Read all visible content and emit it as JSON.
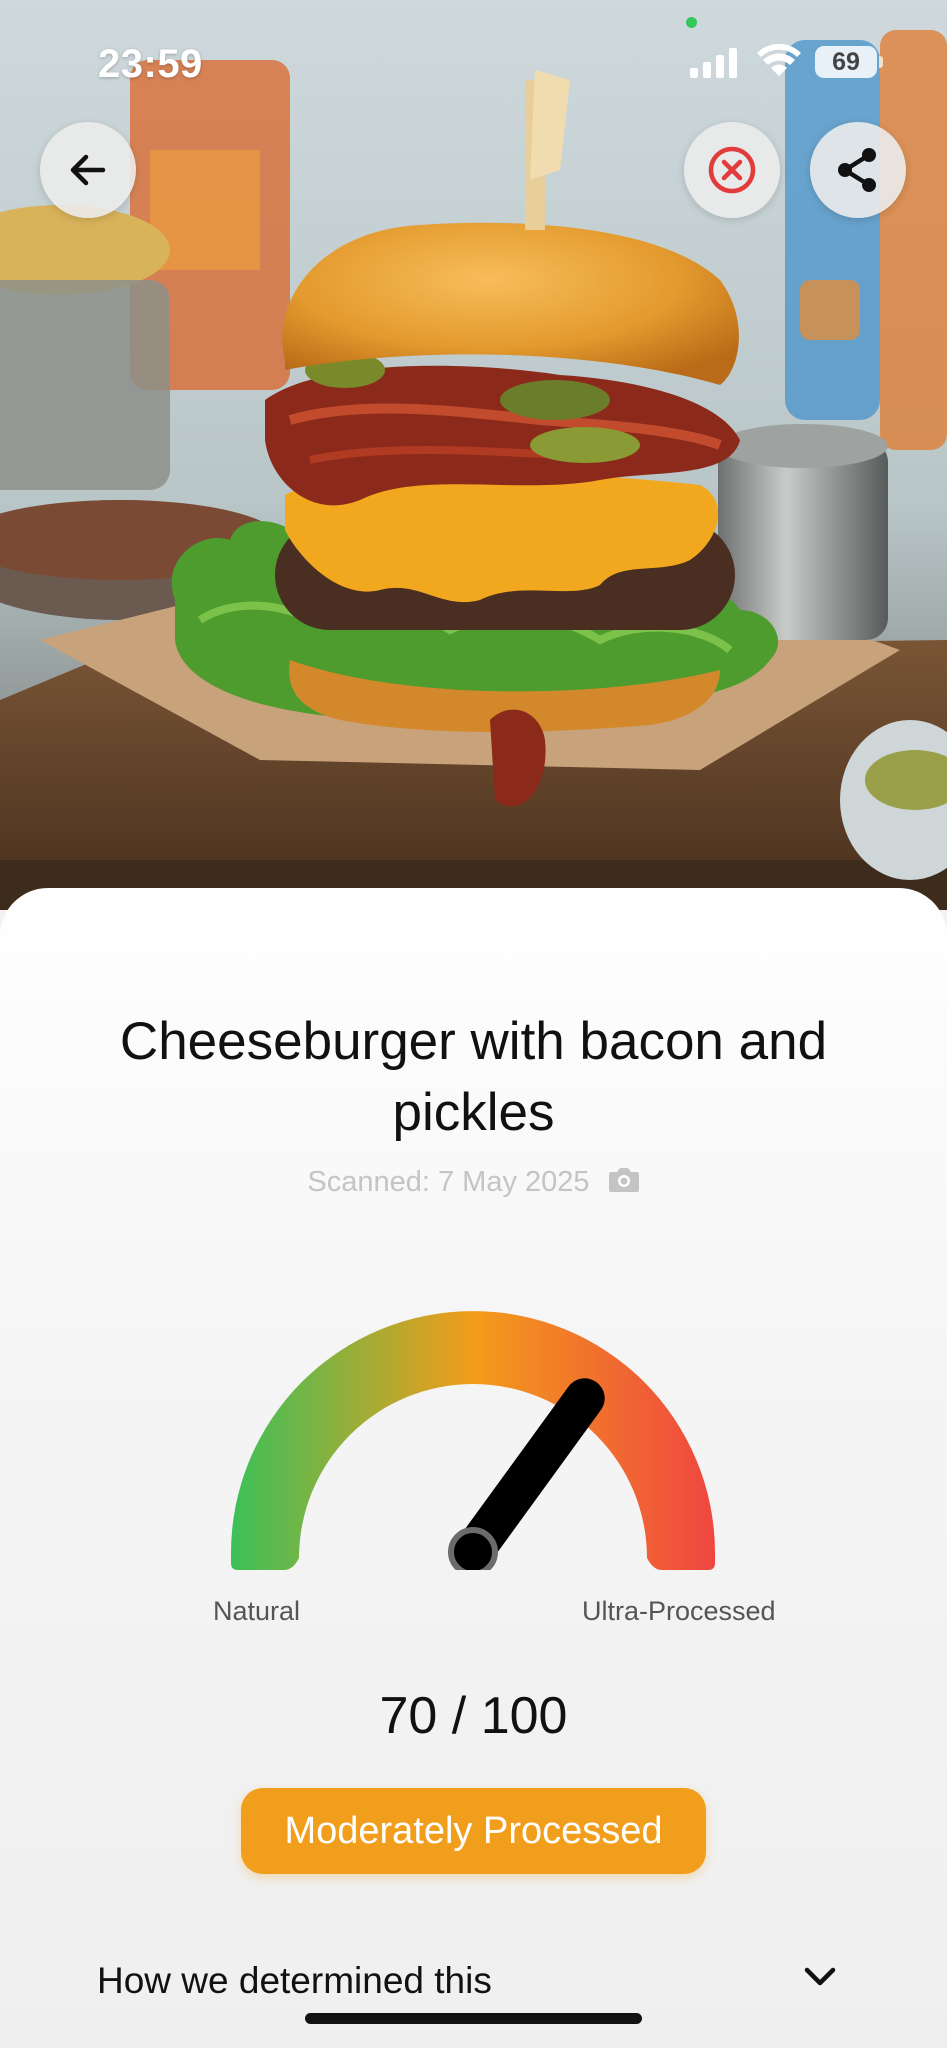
{
  "status_bar": {
    "time": "23:59",
    "battery": "69"
  },
  "header": {
    "back_icon": "arrow-left-icon",
    "close_icon": "circle-x-icon",
    "share_icon": "share-icon"
  },
  "product": {
    "title": "Cheeseburger with bacon and pickles",
    "scanned": "Scanned: 7 May 2025",
    "scanned_icon": "camera-icon"
  },
  "gauge": {
    "score": 70,
    "max": 100,
    "left_label": "Natural",
    "right_label": "Ultra-Processed",
    "colors": [
      "#3cc059",
      "#f39c1a",
      "#ef4640"
    ]
  },
  "score_text": "70 / 100",
  "classification": {
    "label": "Moderately Processed",
    "color": "#f29e1d"
  },
  "details": {
    "label": "How we determined this",
    "icon": "chevron-down-icon"
  }
}
